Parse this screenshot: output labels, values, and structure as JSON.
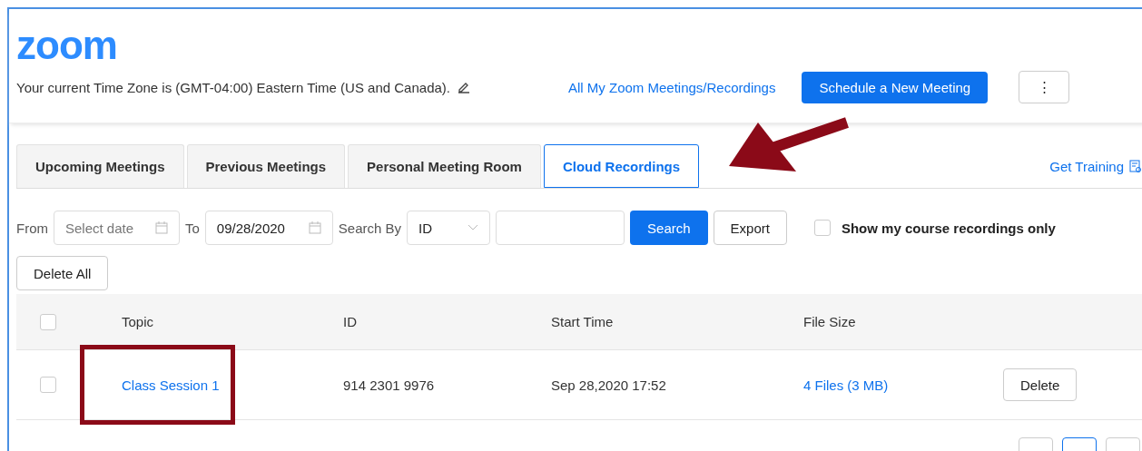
{
  "header": {
    "logo": "zoom",
    "timezone": "Your current Time Zone is (GMT-04:00) Eastern Time (US and Canada).",
    "all_link": "All My Zoom Meetings/Recordings",
    "schedule_button": "Schedule a New Meeting",
    "more_button": "⋮"
  },
  "tabs": [
    {
      "label": "Upcoming Meetings",
      "selected": false
    },
    {
      "label": "Previous Meetings",
      "selected": false
    },
    {
      "label": "Personal Meeting Room",
      "selected": false
    },
    {
      "label": "Cloud Recordings",
      "selected": true
    }
  ],
  "training_link": "Get Training",
  "filters": {
    "from_label": "From",
    "from_placeholder": "Select date",
    "to_label": "To",
    "to_value": "09/28/2020",
    "search_by_label": "Search By",
    "search_by_value": "ID",
    "search_button": "Search",
    "export_button": "Export",
    "course_only": {
      "label": "Show my course recordings only",
      "checked": false
    },
    "delete_all": "Delete All"
  },
  "table": {
    "all_checked": false,
    "columns": [
      "Topic",
      "ID",
      "Start Time",
      "File Size"
    ],
    "rows": [
      {
        "checked": false,
        "topic": "Class Session 1",
        "id": "914 2301 9976",
        "start_time": "Sep 28,2020 17:52",
        "file_size": "4 Files (3 MB)",
        "action": "Delete"
      }
    ]
  },
  "pagination": [
    {
      "selected": false
    },
    {
      "selected": true
    },
    {
      "selected": false
    }
  ]
}
